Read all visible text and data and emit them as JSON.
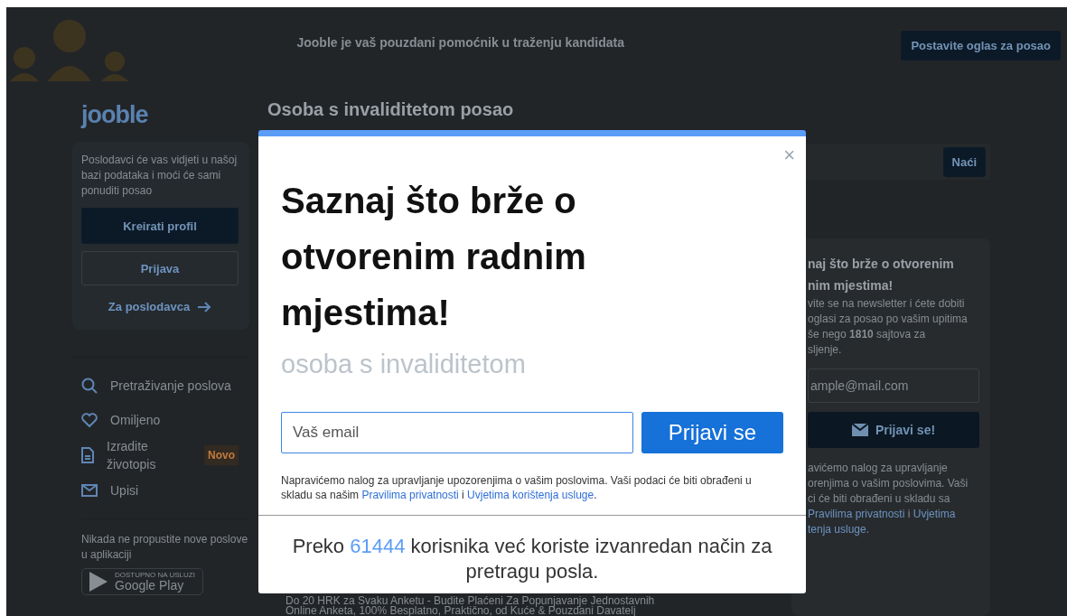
{
  "header": {
    "tagline": "Jooble je vaš pouzdani pomoćnik u traženju kandidata",
    "post_job_button": "Postavite oglas za posao"
  },
  "sidebar": {
    "logo": "jooble",
    "promo_text": "Poslodavci će vas vidjeti u našoj bazi podataka i moći će sami ponuditi posao",
    "create_profile_button": "Kreirati profil",
    "login_button": "Prijava",
    "employer_link": "Za poslodavca",
    "nav": [
      {
        "kind": "search",
        "label": "Pretraživanje poslova"
      },
      {
        "kind": "heart",
        "label": "Omiljeno"
      },
      {
        "kind": "document",
        "label": "Izradite životopis",
        "badge": "Novo"
      },
      {
        "kind": "mail",
        "label": "Upisi"
      }
    ],
    "app_text": "Nikada ne propustite nove poslove u aplikaciji",
    "store_badge": {
      "small": "DOSTUPNO NA USLUZI",
      "name": "Google Play"
    }
  },
  "main": {
    "title": "Osoba s invaliditetom posao",
    "search_button": "Naći",
    "ad_lines": [
      "Do 20 HRK za Svaku Anketu - Budite Plaćeni Za Popunjavanje Jednostavnih",
      "Online Anketa, 100% Besplatno, Praktično, od Kuće & Pouzdani Davatelj"
    ]
  },
  "newsletter_card": {
    "title_lines": [
      "naj što brže o otvorenim",
      "nim mjestima!"
    ],
    "body_lines": [
      "vite se na newsletter i ćete dobiti",
      "oglasi za posao po vašim upitima",
      "še nego **1810** sajtova za",
      "sljenje."
    ],
    "email_placeholder": "ample@mail.com",
    "button": "Prijavi se!",
    "note_lines": [
      [
        {
          "text": "avićemo nalog za upravljanje",
          "link": false
        }
      ],
      [
        {
          "text": "orenjima o vašim poslovima. Vaši",
          "link": false
        }
      ],
      [
        {
          "text": "ci će biti obrađeni u skladu sa",
          "link": false
        }
      ],
      [
        {
          "text": "Pravilima privatnosti",
          "link": true
        },
        {
          "text": " i ",
          "link": false
        },
        {
          "text": "Uvjetima",
          "link": true
        }
      ],
      [
        {
          "text": "tenja usluge.",
          "link": true
        }
      ]
    ]
  },
  "modal": {
    "close": "×",
    "heading": "Saznaj što brže o otvorenim radnim mjestima!",
    "query": "osoba s invaliditetom",
    "email_placeholder": "Vaš email",
    "submit_button": "Prijavi se",
    "note_before": "Napravićemo nalog za upravljanje upozorenjima o vašim poslovima. Vaši podaci će biti obrađeni u skladu sa našim",
    "privacy_link": "Pravilima privatnosti",
    "note_and": "i",
    "terms_link": "Uvjetima korištenja usluge",
    "note_end": ".",
    "footer_before": "Preko",
    "footer_count": "61444",
    "footer_after": "korisnika već koriste izvanredan način za pretragu posla."
  }
}
